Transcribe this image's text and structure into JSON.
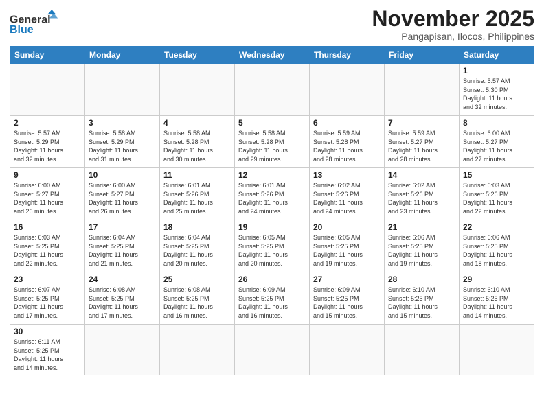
{
  "header": {
    "logo_general": "General",
    "logo_blue": "Blue",
    "month_title": "November 2025",
    "subtitle": "Pangapisan, Ilocos, Philippines"
  },
  "weekdays": [
    "Sunday",
    "Monday",
    "Tuesday",
    "Wednesday",
    "Thursday",
    "Friday",
    "Saturday"
  ],
  "weeks": [
    [
      {
        "day": "",
        "info": ""
      },
      {
        "day": "",
        "info": ""
      },
      {
        "day": "",
        "info": ""
      },
      {
        "day": "",
        "info": ""
      },
      {
        "day": "",
        "info": ""
      },
      {
        "day": "",
        "info": ""
      },
      {
        "day": "1",
        "info": "Sunrise: 5:57 AM\nSunset: 5:30 PM\nDaylight: 11 hours\nand 32 minutes."
      }
    ],
    [
      {
        "day": "2",
        "info": "Sunrise: 5:57 AM\nSunset: 5:29 PM\nDaylight: 11 hours\nand 32 minutes."
      },
      {
        "day": "3",
        "info": "Sunrise: 5:58 AM\nSunset: 5:29 PM\nDaylight: 11 hours\nand 31 minutes."
      },
      {
        "day": "4",
        "info": "Sunrise: 5:58 AM\nSunset: 5:28 PM\nDaylight: 11 hours\nand 30 minutes."
      },
      {
        "day": "5",
        "info": "Sunrise: 5:58 AM\nSunset: 5:28 PM\nDaylight: 11 hours\nand 29 minutes."
      },
      {
        "day": "6",
        "info": "Sunrise: 5:59 AM\nSunset: 5:28 PM\nDaylight: 11 hours\nand 28 minutes."
      },
      {
        "day": "7",
        "info": "Sunrise: 5:59 AM\nSunset: 5:27 PM\nDaylight: 11 hours\nand 28 minutes."
      },
      {
        "day": "8",
        "info": "Sunrise: 6:00 AM\nSunset: 5:27 PM\nDaylight: 11 hours\nand 27 minutes."
      }
    ],
    [
      {
        "day": "9",
        "info": "Sunrise: 6:00 AM\nSunset: 5:27 PM\nDaylight: 11 hours\nand 26 minutes."
      },
      {
        "day": "10",
        "info": "Sunrise: 6:00 AM\nSunset: 5:27 PM\nDaylight: 11 hours\nand 26 minutes."
      },
      {
        "day": "11",
        "info": "Sunrise: 6:01 AM\nSunset: 5:26 PM\nDaylight: 11 hours\nand 25 minutes."
      },
      {
        "day": "12",
        "info": "Sunrise: 6:01 AM\nSunset: 5:26 PM\nDaylight: 11 hours\nand 24 minutes."
      },
      {
        "day": "13",
        "info": "Sunrise: 6:02 AM\nSunset: 5:26 PM\nDaylight: 11 hours\nand 24 minutes."
      },
      {
        "day": "14",
        "info": "Sunrise: 6:02 AM\nSunset: 5:26 PM\nDaylight: 11 hours\nand 23 minutes."
      },
      {
        "day": "15",
        "info": "Sunrise: 6:03 AM\nSunset: 5:26 PM\nDaylight: 11 hours\nand 22 minutes."
      }
    ],
    [
      {
        "day": "16",
        "info": "Sunrise: 6:03 AM\nSunset: 5:25 PM\nDaylight: 11 hours\nand 22 minutes."
      },
      {
        "day": "17",
        "info": "Sunrise: 6:04 AM\nSunset: 5:25 PM\nDaylight: 11 hours\nand 21 minutes."
      },
      {
        "day": "18",
        "info": "Sunrise: 6:04 AM\nSunset: 5:25 PM\nDaylight: 11 hours\nand 20 minutes."
      },
      {
        "day": "19",
        "info": "Sunrise: 6:05 AM\nSunset: 5:25 PM\nDaylight: 11 hours\nand 20 minutes."
      },
      {
        "day": "20",
        "info": "Sunrise: 6:05 AM\nSunset: 5:25 PM\nDaylight: 11 hours\nand 19 minutes."
      },
      {
        "day": "21",
        "info": "Sunrise: 6:06 AM\nSunset: 5:25 PM\nDaylight: 11 hours\nand 19 minutes."
      },
      {
        "day": "22",
        "info": "Sunrise: 6:06 AM\nSunset: 5:25 PM\nDaylight: 11 hours\nand 18 minutes."
      }
    ],
    [
      {
        "day": "23",
        "info": "Sunrise: 6:07 AM\nSunset: 5:25 PM\nDaylight: 11 hours\nand 17 minutes."
      },
      {
        "day": "24",
        "info": "Sunrise: 6:08 AM\nSunset: 5:25 PM\nDaylight: 11 hours\nand 17 minutes."
      },
      {
        "day": "25",
        "info": "Sunrise: 6:08 AM\nSunset: 5:25 PM\nDaylight: 11 hours\nand 16 minutes."
      },
      {
        "day": "26",
        "info": "Sunrise: 6:09 AM\nSunset: 5:25 PM\nDaylight: 11 hours\nand 16 minutes."
      },
      {
        "day": "27",
        "info": "Sunrise: 6:09 AM\nSunset: 5:25 PM\nDaylight: 11 hours\nand 15 minutes."
      },
      {
        "day": "28",
        "info": "Sunrise: 6:10 AM\nSunset: 5:25 PM\nDaylight: 11 hours\nand 15 minutes."
      },
      {
        "day": "29",
        "info": "Sunrise: 6:10 AM\nSunset: 5:25 PM\nDaylight: 11 hours\nand 14 minutes."
      }
    ],
    [
      {
        "day": "30",
        "info": "Sunrise: 6:11 AM\nSunset: 5:25 PM\nDaylight: 11 hours\nand 14 minutes."
      },
      {
        "day": "",
        "info": ""
      },
      {
        "day": "",
        "info": ""
      },
      {
        "day": "",
        "info": ""
      },
      {
        "day": "",
        "info": ""
      },
      {
        "day": "",
        "info": ""
      },
      {
        "day": "",
        "info": ""
      }
    ]
  ]
}
